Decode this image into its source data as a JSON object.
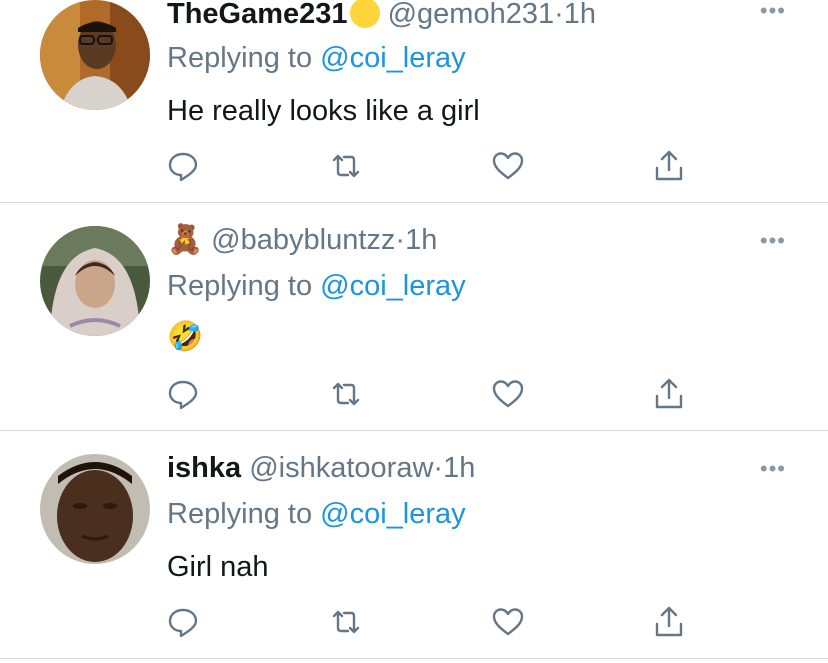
{
  "tweets": [
    {
      "display_name": "TheGame231",
      "handle": "@gemoh231",
      "separator": "·",
      "time": "1h",
      "replying_prefix": "Replying to ",
      "replying_to": "@coi_leray",
      "text": "He really looks like a girl",
      "name_emoji": "yellow-circle",
      "avatar": "man-with-glasses"
    },
    {
      "display_name": "",
      "handle": "@babybluntzz",
      "separator": "·",
      "time": "1h",
      "replying_prefix": "Replying to ",
      "replying_to": "@coi_leray",
      "text": "🤣",
      "name_emoji_char": "🧸",
      "avatar": "woman-in-hoodie"
    },
    {
      "display_name": "ishka",
      "handle": "@ishkatooraw",
      "separator": "·",
      "time": "1h",
      "replying_prefix": "Replying to ",
      "replying_to": "@coi_leray",
      "text": "Girl nah",
      "avatar": "person-selfie"
    }
  ],
  "colors": {
    "mention": "#1b95e0",
    "secondary_text": "#657786",
    "divider": "#d9dde0"
  },
  "icons": [
    "reply-icon",
    "retweet-icon",
    "like-icon",
    "share-icon",
    "more-options-icon"
  ]
}
